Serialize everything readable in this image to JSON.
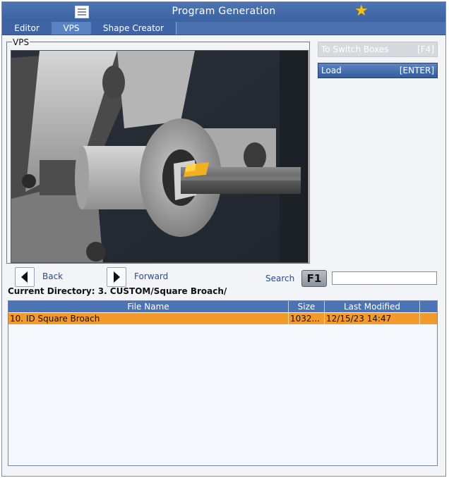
{
  "window": {
    "title": "Program Generation"
  },
  "tabs": [
    {
      "label": "Editor",
      "active": false
    },
    {
      "label": "VPS",
      "active": true
    },
    {
      "label": "Shape Creator",
      "active": false
    }
  ],
  "vps": {
    "legend": "VPS"
  },
  "side_buttons": {
    "switch": {
      "label": "To Switch Boxes",
      "key": "[F4]"
    },
    "load": {
      "label": "Load",
      "key": "[ENTER]"
    }
  },
  "nav": {
    "back_label": "Back",
    "forward_label": "Forward"
  },
  "search": {
    "label": "Search",
    "key": "F1",
    "value": ""
  },
  "current_directory": "Current Directory: 3. CUSTOM/Square Broach/",
  "file_table": {
    "columns": [
      "File Name",
      "Size",
      "Last Modified"
    ],
    "rows": [
      {
        "name": "10. ID Square Broach",
        "size": "1032...",
        "modified": "12/15/23 14:47",
        "selected": true
      }
    ]
  },
  "colors": {
    "title_bar": "#3c62a0",
    "selected_row": "#f39a2d",
    "star": "#f1c21b"
  }
}
